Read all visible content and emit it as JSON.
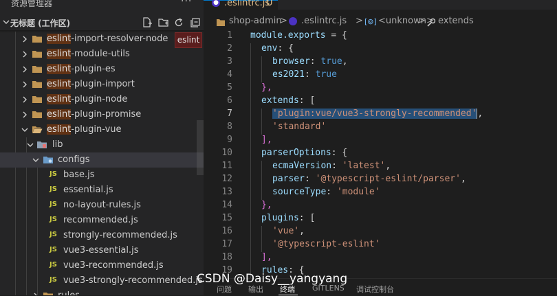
{
  "sidebar": {
    "title": "资源管理器",
    "more": "···",
    "workspace": "无标题 (工作区)",
    "badge": "eslint",
    "items": [
      {
        "label": "eslint-import-resolver-node",
        "highlight": "eslint",
        "rest": "-import-resolver-node"
      },
      {
        "label": "eslint-module-utils",
        "highlight": "eslint",
        "rest": "-module-utils"
      },
      {
        "label": "eslint-plugin-es",
        "highlight": "eslint",
        "rest": "-plugin-es"
      },
      {
        "label": "eslint-plugin-import",
        "highlight": "eslint",
        "rest": "-plugin-import"
      },
      {
        "label": "eslint-plugin-node",
        "highlight": "eslint",
        "rest": "-plugin-node"
      },
      {
        "label": "eslint-plugin-promise",
        "highlight": "eslint",
        "rest": "-plugin-promise"
      },
      {
        "label": "eslint-plugin-vue",
        "highlight": "eslint",
        "rest": "-plugin-vue"
      },
      {
        "label": "lib"
      },
      {
        "label": "configs"
      },
      {
        "label": "base.js"
      },
      {
        "label": "essential.js"
      },
      {
        "label": "no-layout-rules.js"
      },
      {
        "label": "recommended.js"
      },
      {
        "label": "strongly-recommended.js"
      },
      {
        "label": "vue3-essential.js"
      },
      {
        "label": "vue3-recommended.js"
      },
      {
        "label": "vue3-strongly-recommended.js"
      },
      {
        "label": "rules"
      }
    ],
    "js_badge": "JS"
  },
  "tab": {
    "label": ".eslintrc.js",
    "status": "U"
  },
  "breadcrumb": {
    "folder": "shop-admin",
    "sep": ">",
    "file": ".eslintrc.js",
    "symbol": "<unknown>",
    "property": "extends"
  },
  "code": {
    "line_numbers": [
      "1",
      "2",
      "3",
      "4",
      "5",
      "6",
      "7",
      "8",
      "9",
      "10",
      "11",
      "12",
      "13",
      "14",
      "15",
      "16",
      "17",
      "18",
      "19"
    ],
    "active_line": "7",
    "lines": {
      "l1a": "module.exports",
      "l1b": " = {",
      "l2a": "env",
      "l2b": ": {",
      "l3a": "browser",
      "l3b": ": ",
      "l3c": "true",
      "l3d": ",",
      "l4a": "es2021",
      "l4b": ": ",
      "l4c": "true",
      "l5": "},",
      "l6a": "extends",
      "l6b": ": [",
      "l7a": "'plugin:vue/vue3-strongly-recommended'",
      "l7b": ",",
      "l8": "'standard'",
      "l9": "],",
      "l10a": "parserOptions",
      "l10b": ": {",
      "l11a": "ecmaVersion",
      "l11b": ": ",
      "l11c": "'latest'",
      "l11d": ",",
      "l12a": "parser",
      "l12b": ": ",
      "l12c": "'@typescript-eslint/parser'",
      "l12d": ",",
      "l13a": "sourceType",
      "l13b": ": ",
      "l13c": "'module'",
      "l14": "},",
      "l15a": "plugins",
      "l15b": ": [",
      "l16a": "'vue'",
      "l16b": ",",
      "l17": "'@typescript-eslint'",
      "l18": "],",
      "l19a": "rules",
      "l19b": ": {"
    }
  },
  "panel": {
    "tabs": [
      "问题",
      "输出",
      "终端",
      "GITLENS",
      "调试控制台"
    ],
    "active": "终端"
  },
  "watermark": "CSDN @Daisy__yangyang",
  "colors": {
    "accent": "#007acc",
    "highlight": "#613214",
    "selection": "#264f78",
    "string": "#ce9178",
    "keyword": "#569cd6",
    "property": "#9cdcfe"
  }
}
